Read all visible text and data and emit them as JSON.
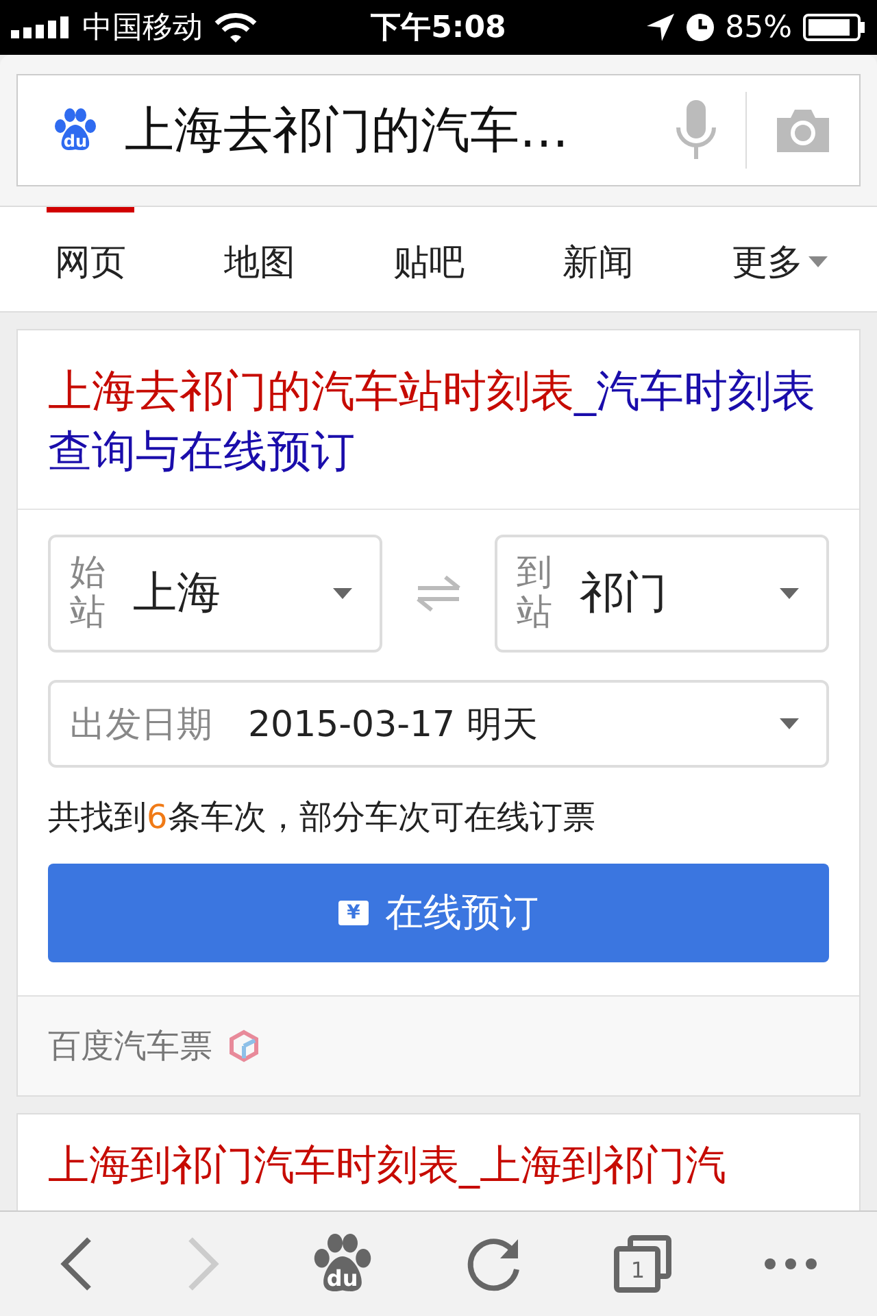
{
  "status_bar": {
    "carrier": "中国移动",
    "time": "下午5:08",
    "battery": "85%"
  },
  "search": {
    "logo_text": "du",
    "query": "上海去祁门的汽车…"
  },
  "tabs": [
    {
      "label": "网页",
      "selected": true,
      "dropdown": false
    },
    {
      "label": "地图",
      "selected": false,
      "dropdown": false
    },
    {
      "label": "贴吧",
      "selected": false,
      "dropdown": false
    },
    {
      "label": "新闻",
      "selected": false,
      "dropdown": false
    },
    {
      "label": "更多",
      "selected": false,
      "dropdown": true
    }
  ],
  "result": {
    "title_parts": [
      {
        "text": "上海去祁门的汽车站时刻表",
        "color": "#c60a00"
      },
      {
        "text": "_汽车时刻表查询与在线预订",
        "color": "#1a0dab"
      }
    ],
    "from": {
      "label": "始站",
      "value": "上海"
    },
    "to": {
      "label": "到站",
      "value": "祁门"
    },
    "date": {
      "label": "出发日期",
      "value": "2015-03-17 明天"
    },
    "info_parts": [
      {
        "text": "共找到",
        "highlight": false
      },
      {
        "text": "6",
        "highlight": true
      },
      {
        "text": "条车次，部分车次可在线订票",
        "highlight": false
      }
    ],
    "book_button": {
      "icon_text": "¥",
      "label": "在线预订"
    },
    "source": "百度汽车票"
  },
  "next_result": {
    "title": "上海到祁门汽车时刻表_上海到祁门汽"
  },
  "toolbar": {
    "back_disabled": false,
    "forward_disabled": true,
    "logo_text": "du",
    "tab_count": "1"
  }
}
